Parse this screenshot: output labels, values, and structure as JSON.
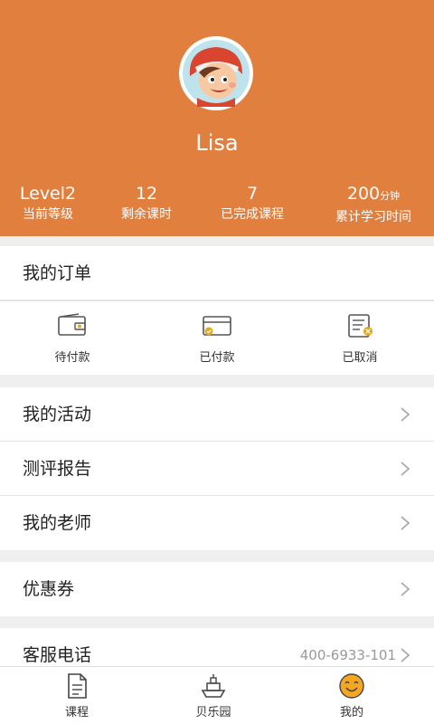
{
  "profile": {
    "name": "Lisa"
  },
  "stats": [
    {
      "value": "Level2",
      "unit": "",
      "label": "当前等级"
    },
    {
      "value": "12",
      "unit": "",
      "label": "剩余课时"
    },
    {
      "value": "7",
      "unit": "",
      "label": "已完成课程"
    },
    {
      "value": "200",
      "unit": "分钟",
      "label": "累计学习时间"
    }
  ],
  "orders": {
    "title": "我的订单",
    "items": [
      {
        "label": "待付款",
        "icon": "wallet-icon"
      },
      {
        "label": "已付款",
        "icon": "paid-card-icon"
      },
      {
        "label": "已取消",
        "icon": "cancelled-doc-icon"
      }
    ]
  },
  "menu": {
    "activities": "我的活动",
    "report": "测评报告",
    "teachers": "我的老师",
    "coupons": "优惠券",
    "service_label": "客服电话",
    "service_phone": "400-6933-101"
  },
  "nav": [
    {
      "label": "课程",
      "icon": "document-icon"
    },
    {
      "label": "贝乐园",
      "icon": "boat-icon"
    },
    {
      "label": "我的",
      "icon": "smiley-face-icon"
    }
  ],
  "colors": {
    "accent": "#e07f3e",
    "active_icon": "#f5a623"
  }
}
